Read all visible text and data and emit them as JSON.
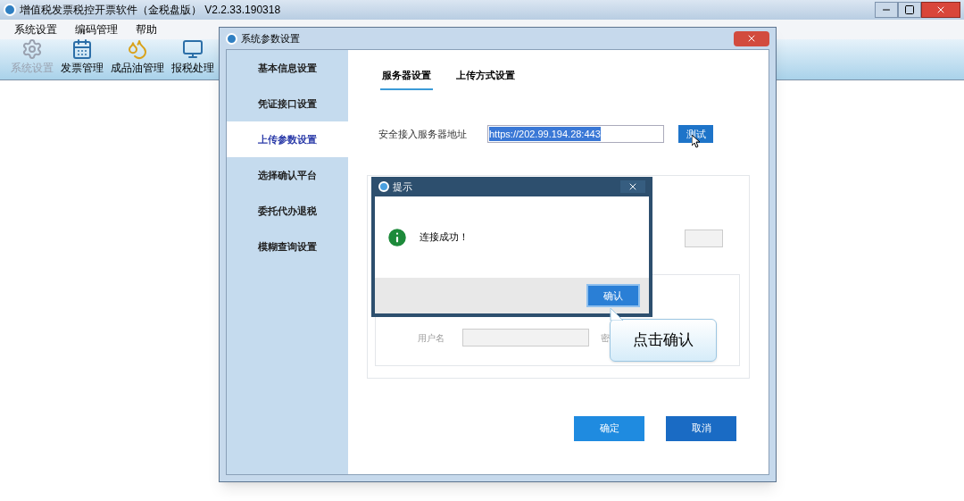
{
  "app": {
    "title": "增值税发票税控开票软件（金税盘版） V2.2.33.190318"
  },
  "menu": [
    "系统设置",
    "编码管理",
    "帮助"
  ],
  "toolbar": [
    {
      "label": "系统设置",
      "kind": "gear",
      "disabled": true
    },
    {
      "label": "发票管理",
      "kind": "calendar",
      "disabled": false
    },
    {
      "label": "成品油管理",
      "kind": "oil",
      "disabled": false
    },
    {
      "label": "报税处理",
      "kind": "monitor",
      "disabled": false
    }
  ],
  "dialog": {
    "title": "系统参数设置",
    "nav": [
      {
        "label": "基本信息设置",
        "selected": false
      },
      {
        "label": "凭证接口设置",
        "selected": false
      },
      {
        "label": "上传参数设置",
        "selected": true
      },
      {
        "label": "选择确认平台",
        "selected": false
      },
      {
        "label": "委托代办退税",
        "selected": false
      },
      {
        "label": "模糊查询设置",
        "selected": false
      }
    ],
    "tabs": [
      {
        "label": "服务器设置",
        "selected": true
      },
      {
        "label": "上传方式设置",
        "selected": false
      }
    ],
    "server_label": "安全接入服务器地址",
    "server_value": "https://202.99.194.28:443",
    "test_button": "测试",
    "username_label": "用户名",
    "password_label": "密",
    "buttons": [
      "确定",
      "取消"
    ]
  },
  "popup": {
    "title": "提示",
    "message": "连接成功！",
    "ok_button": "确认"
  },
  "callout": "点击确认"
}
